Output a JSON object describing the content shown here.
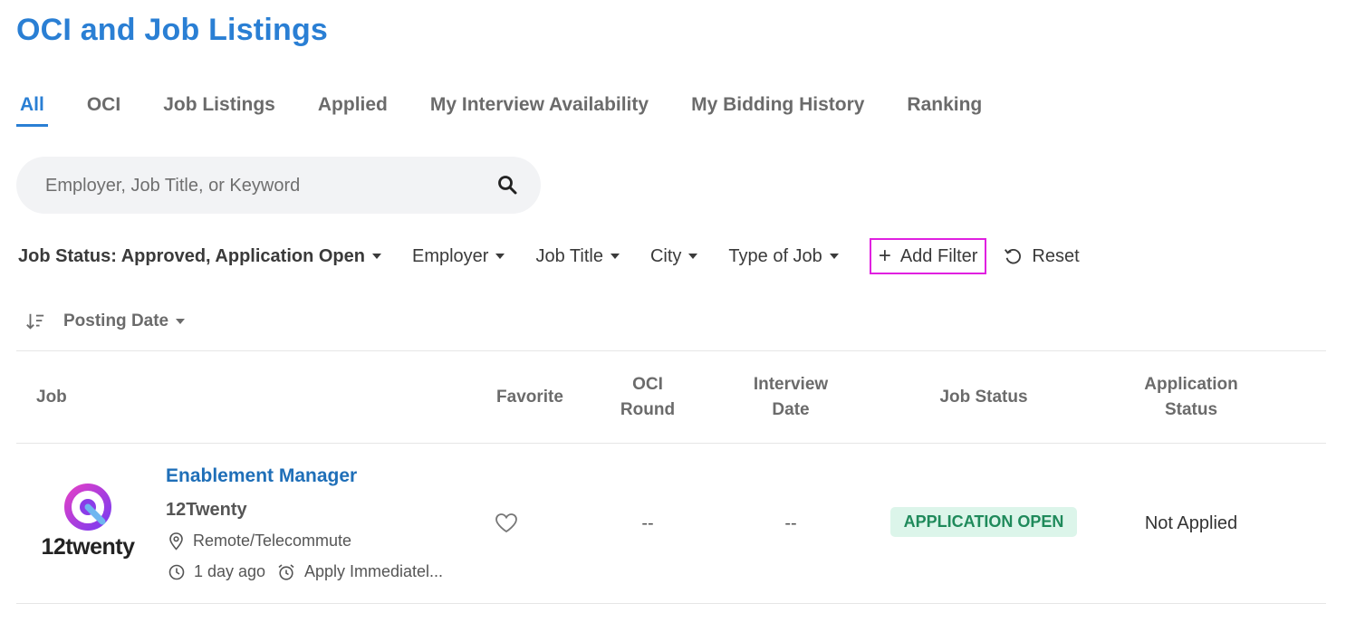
{
  "page_title": "OCI and Job Listings",
  "tabs": [
    {
      "label": "All",
      "active": true
    },
    {
      "label": "OCI"
    },
    {
      "label": "Job Listings"
    },
    {
      "label": "Applied"
    },
    {
      "label": "My Interview Availability"
    },
    {
      "label": "My Bidding History"
    },
    {
      "label": "Ranking"
    }
  ],
  "search": {
    "placeholder": "Employer, Job Title, or Keyword",
    "icon": "search-icon"
  },
  "filters": {
    "job_status": "Job Status: Approved, Application Open",
    "employer": "Employer",
    "job_title": "Job Title",
    "city": "City",
    "type_of_job": "Type of Job",
    "add_filter": "Add Filter",
    "reset": "Reset"
  },
  "sort": {
    "label": "Posting Date"
  },
  "table": {
    "headers": {
      "job": "Job",
      "favorite": "Favorite",
      "oci_round_1": "OCI",
      "oci_round_2": "Round",
      "interview_1": "Interview",
      "interview_2": "Date",
      "job_status": "Job Status",
      "app_status_1": "Application",
      "app_status_2": "Status"
    },
    "rows": [
      {
        "logo_text": "12twenty",
        "title": "Enablement Manager",
        "employer": "12Twenty",
        "location": "Remote/Telecommute",
        "posted": "1 day ago",
        "deadline": "Apply Immediatel...",
        "oci_round": "--",
        "interview_date": "--",
        "job_status": "APPLICATION OPEN",
        "application_status": "Not Applied"
      }
    ]
  },
  "colors": {
    "accent": "#2a7fd4",
    "highlight": "#e020e0",
    "badge_bg": "#dcf5ea",
    "badge_text": "#1f8a5b"
  }
}
